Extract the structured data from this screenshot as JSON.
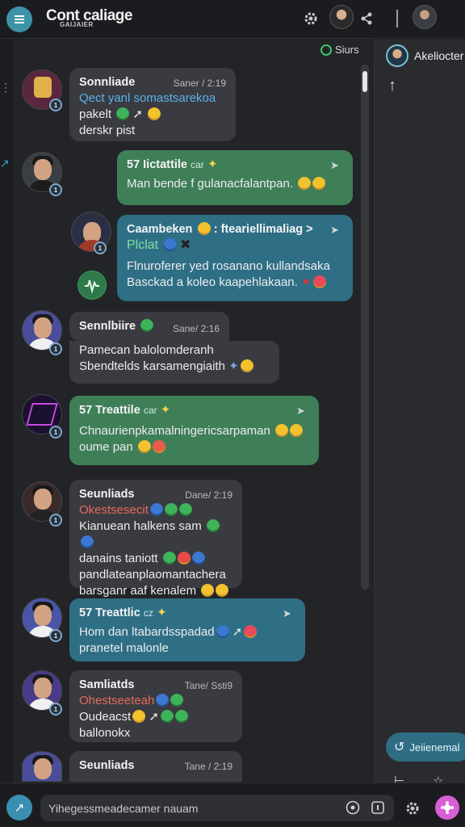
{
  "header": {
    "title": "Cont caliage",
    "subtitle": "GAIJAIER",
    "status": "Siurs"
  },
  "messages": [
    {
      "name": "Sonnliade",
      "time": "Saner / 2:19",
      "sub": "Qect yanl somastsarekoa",
      "lines": [
        "pakelt",
        "derskr pist"
      ],
      "style": "grey"
    },
    {
      "name": "57 Iictattile",
      "tag": "car",
      "lines": [
        "Man bende f gulanacfalantpan."
      ],
      "style": "green"
    },
    {
      "name": "Caambeken",
      "extra": ": fteariellimaliag >",
      "sub": "Plclat",
      "lines": [
        "Flnuroferer yed rosanano kullandsaka",
        "Basckad a koleo kaapehlakaan."
      ],
      "style": "teal"
    },
    {
      "name": "Sennlbiire",
      "time": "Sane/ 2:16",
      "lines": [
        "Pamecan balolomderanh",
        "Sbendtelds karsamengiaith"
      ],
      "style": "grey"
    },
    {
      "name": "57 Treattile",
      "tag": "car",
      "lines": [
        "Chnaurienpkamalningericsarpaman",
        "oume pan"
      ],
      "style": "green"
    },
    {
      "name": "Seunliads",
      "time": "Dane/ 2:19",
      "sub": "Okestsesecit",
      "lines": [
        "Kianuean halkens sam",
        "danains taniott",
        "pandlateanplaomantachera",
        "barsganr aaf kenalem"
      ],
      "style": "grey"
    },
    {
      "name": "57 Treattlic",
      "tag": "cz",
      "lines": [
        "Hom dan ltabardsspadad",
        "pranetel malonle"
      ],
      "style": "teal"
    },
    {
      "name": "Samliatds",
      "time": "Tane/ Ssti9",
      "sub": "Ohestseeteah",
      "lines": [
        "Oudeacst",
        "ballonokx"
      ],
      "style": "grey"
    },
    {
      "name": "Seunliads",
      "time": "Tane / 2:19",
      "style": "grey"
    }
  ],
  "panel": {
    "user": "Akeliocter",
    "chip": "Jeiienemal"
  },
  "composer": {
    "placeholder": "Yihegessmeadecamer nauam"
  }
}
